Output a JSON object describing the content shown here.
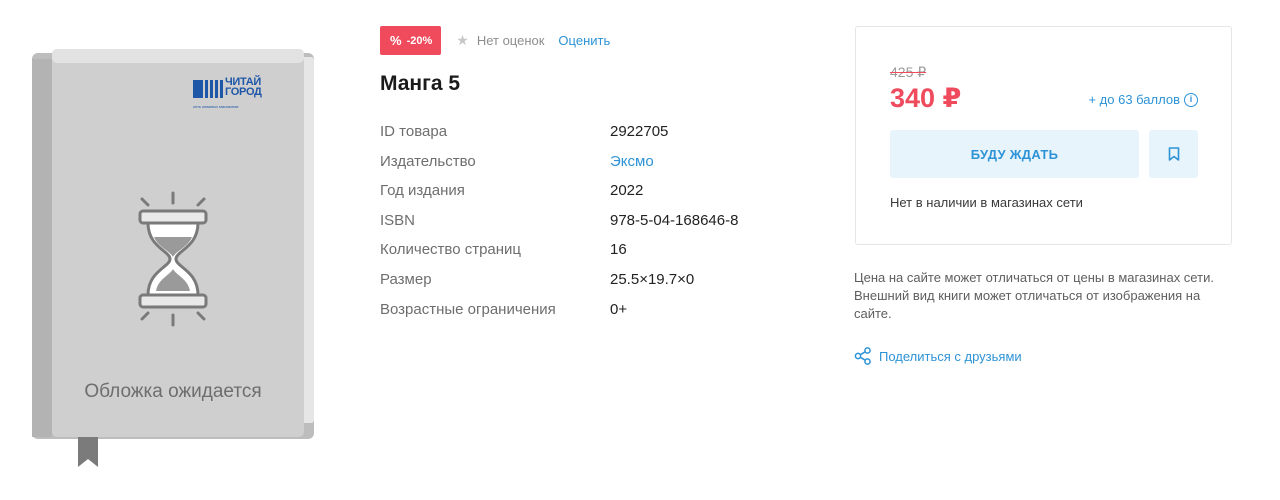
{
  "cover": {
    "logo_top": "ЧИТАЙ",
    "logo_bottom": "ГОРОД",
    "logo_tagline": "сеть книжных магазинов",
    "caption": "Обложка ожидается",
    "icons": [
      "hourglass-icon",
      "bookmark-ribbon"
    ]
  },
  "badges": {
    "discount": "-20%",
    "discount_icon": "percent-icon",
    "rating_icon": "star-icon",
    "rating_text": "Нет оценок",
    "rate_link": "Оценить"
  },
  "product": {
    "title": "Манга 5",
    "properties": [
      {
        "label": "ID товара",
        "value": "2922705"
      },
      {
        "label": "Издательство",
        "value": "Эксмо"
      },
      {
        "label": "Год издания",
        "value": "2022"
      },
      {
        "label": "ISBN",
        "value": "978-5-04-168646-8"
      },
      {
        "label": "Количество страниц",
        "value": "16"
      },
      {
        "label": "Размер",
        "value": "25.5×19.7×0"
      },
      {
        "label": "Возрастные ограничения",
        "value": "0+"
      }
    ]
  },
  "price": {
    "old": "425 ₽",
    "current": "340 ₽",
    "bonus": "+ до 63 баллов",
    "wait_button": "БУДУ ЖДАТЬ",
    "stock_note": "Нет в наличии в магазинах сети"
  },
  "disclaimer": "Цена на сайте может отличаться от цены в магазинах сети. Внешний вид книги может отличаться от изображения на сайте.",
  "share": "Поделиться с друзьями",
  "colors": {
    "accent": "#2d93d6",
    "sale": "#ef4b5d",
    "button_bg": "#e8f4fc"
  }
}
